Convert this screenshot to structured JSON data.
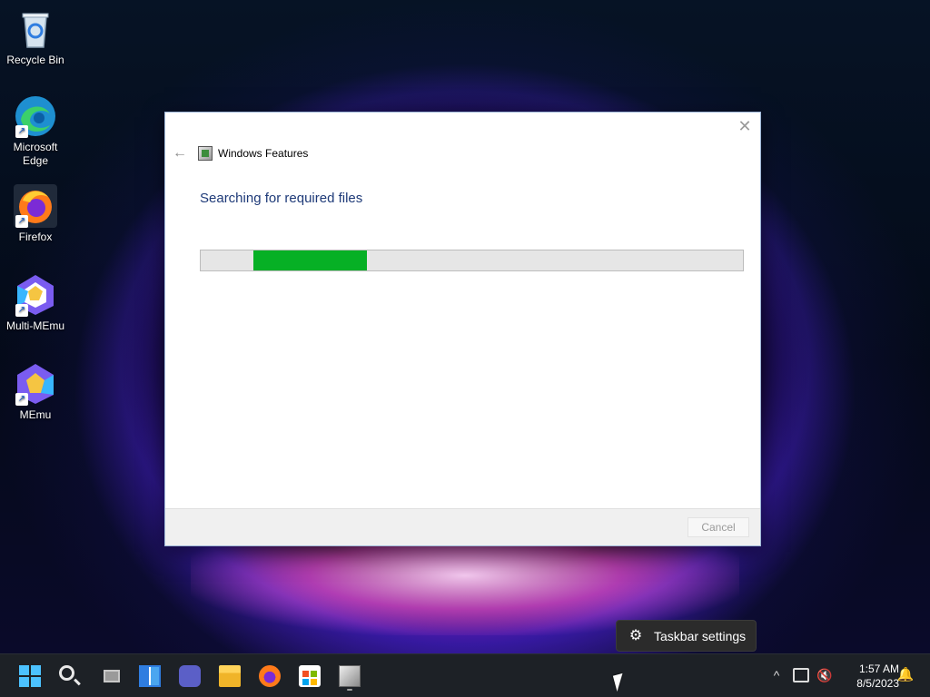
{
  "desktop": {
    "icons": [
      {
        "label": "Recycle Bin",
        "icon": "recycle-bin-icon"
      },
      {
        "label": "Microsoft\nEdge",
        "icon": "edge-icon"
      },
      {
        "label": "Firefox",
        "icon": "firefox-icon"
      },
      {
        "label": "Multi-MEmu",
        "icon": "multi-memu-icon"
      },
      {
        "label": "MEmu",
        "icon": "memu-icon"
      }
    ]
  },
  "dialog": {
    "title": "Windows Features",
    "status": "Searching for required files",
    "progress_percent": 21,
    "cancel_label": "Cancel",
    "close_glyph": "✕",
    "back_glyph": "←"
  },
  "taskbar_popup": {
    "label": "Taskbar settings",
    "icon": "gear-icon"
  },
  "taskbar": {
    "apps": [
      "start-icon",
      "search-icon",
      "task-view-icon",
      "widgets-icon",
      "chat-icon",
      "file-explorer-icon",
      "firefox-icon",
      "store-icon",
      "windows-features-icon"
    ],
    "clock_time": "1:57 AM",
    "clock_date": "8/5/2023"
  },
  "colors": {
    "progress_fill": "#06b025",
    "status_text": "#1e3a78",
    "taskbar_bg": "#1d2126"
  }
}
